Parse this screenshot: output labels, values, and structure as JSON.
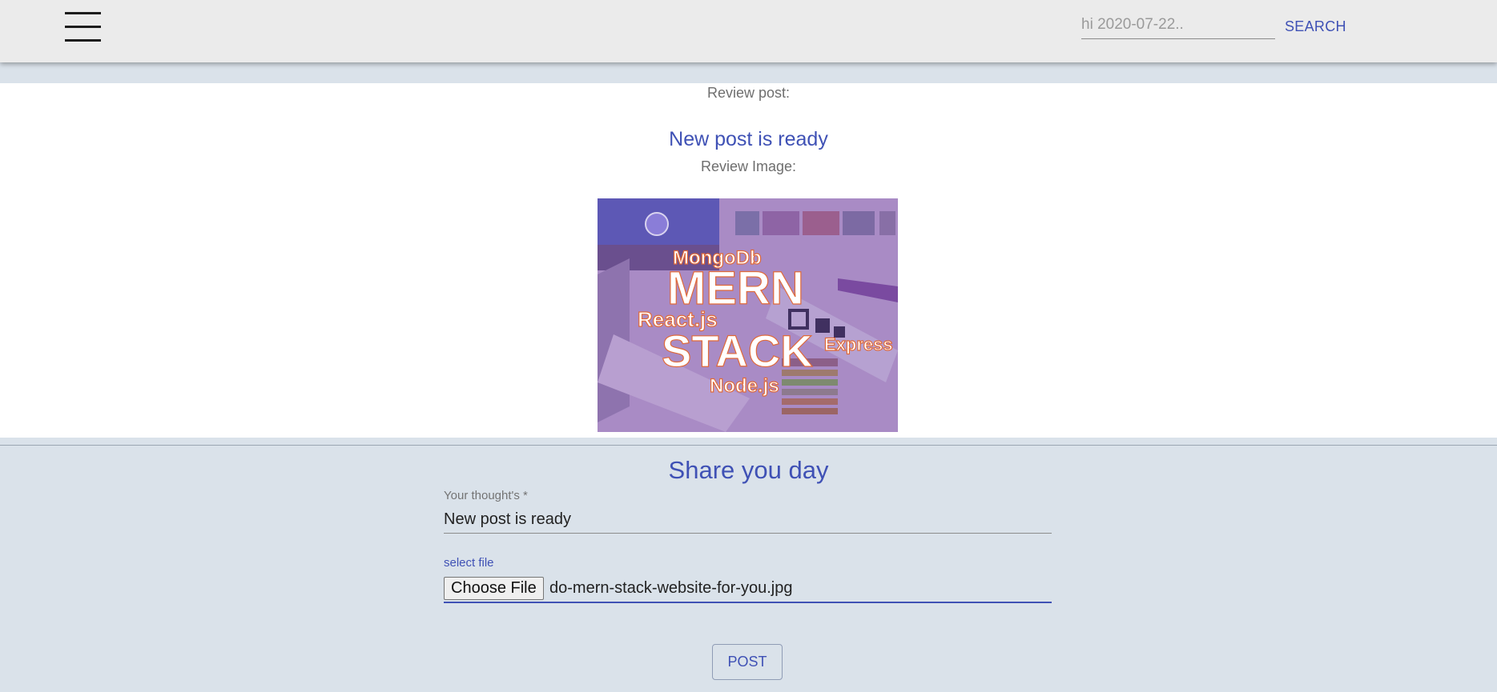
{
  "header": {
    "menu_icon": "hamburger-menu-icon",
    "search": {
      "placeholder": "hi 2020-07-22..",
      "value": "",
      "button_label": "SEARCH"
    }
  },
  "review": {
    "post_label": "Review post:",
    "post_title": "New post is ready",
    "image_label": "Review Image:",
    "image": {
      "texts": {
        "mongodb": "MongoDb",
        "mern": "MERN",
        "react": "React.js",
        "stack": "STACK",
        "express": "Express",
        "node": "Node.js"
      }
    }
  },
  "form": {
    "title": "Share you day",
    "thought_label": "Your thought's *",
    "thought_value": "New post is ready",
    "file_label": "select file",
    "choose_file_label": "Choose File",
    "file_name": "do-mern-stack-website-for-you.jpg",
    "post_button": "POST"
  },
  "colors": {
    "accent": "#3f51b5",
    "appbar": "#ebebeb",
    "background": "#dae2ea"
  }
}
